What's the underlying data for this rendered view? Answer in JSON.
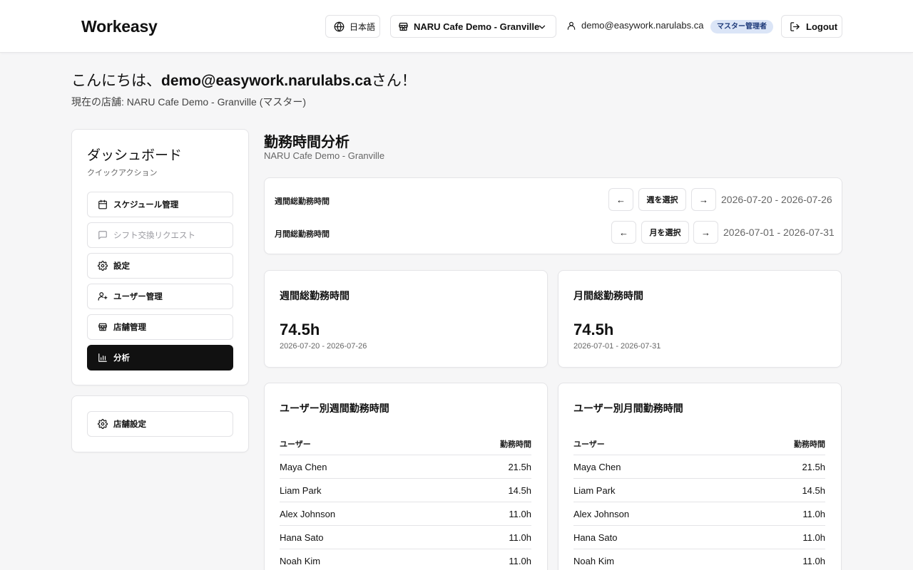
{
  "header": {
    "logo": "Workeasy",
    "language_label": "日本語",
    "store_name": "NARU Cafe Demo - Granville",
    "user_email": "demo@easywork.narulabs.ca",
    "role_badge": "マスター管理者",
    "logout_label": "Logout"
  },
  "greeting": {
    "prefix": "こんにちは、",
    "email": "demo@easywork.narulabs.ca",
    "suffix": "さん！",
    "current_store": "現在の店舗: NARU Cafe Demo - Granville (マスター)"
  },
  "sidebar": {
    "title": "ダッシュボード",
    "subtitle": "クイックアクション",
    "items": [
      {
        "label": "スケジュール管理",
        "icon": "calendar-icon",
        "state": "normal"
      },
      {
        "label": "シフト交換リクエスト",
        "icon": "message-icon",
        "state": "disabled"
      },
      {
        "label": "設定",
        "icon": "gear-icon",
        "state": "normal"
      },
      {
        "label": "ユーザー管理",
        "icon": "user-plus-icon",
        "state": "normal"
      },
      {
        "label": "店舗管理",
        "icon": "store-icon",
        "state": "normal"
      },
      {
        "label": "分析",
        "icon": "bar-chart-icon",
        "state": "active"
      }
    ],
    "store_settings_label": "店舗設定"
  },
  "main": {
    "title": "勤務時間分析",
    "subtitle": "NARU Cafe Demo - Granville",
    "week_selector": {
      "label": "週間総勤務時間",
      "select_label": "週を選択",
      "range": "2026-07-20 - 2026-07-26"
    },
    "month_selector": {
      "label": "月間総勤務時間",
      "select_label": "月を選択",
      "range": "2026-07-01 - 2026-07-31"
    },
    "weekly_total": {
      "title": "週間総勤務時間",
      "value": "74.5h",
      "range": "2026-07-20 - 2026-07-26"
    },
    "monthly_total": {
      "title": "月間総勤務時間",
      "value": "74.5h",
      "range": "2026-07-01 - 2026-07-31"
    },
    "weekly_by_user": {
      "title": "ユーザー別週間勤務時間",
      "col_user": "ユーザー",
      "col_hours": "勤務時間",
      "rows": [
        {
          "name": "Maya Chen",
          "hours": "21.5h"
        },
        {
          "name": "Liam Park",
          "hours": "14.5h"
        },
        {
          "name": "Alex Johnson",
          "hours": "11.0h"
        },
        {
          "name": "Hana Sato",
          "hours": "11.0h"
        },
        {
          "name": "Noah Kim",
          "hours": "11.0h"
        }
      ]
    },
    "monthly_by_user": {
      "title": "ユーザー別月間勤務時間",
      "col_user": "ユーザー",
      "col_hours": "勤務時間",
      "rows": [
        {
          "name": "Maya Chen",
          "hours": "21.5h"
        },
        {
          "name": "Liam Park",
          "hours": "14.5h"
        },
        {
          "name": "Alex Johnson",
          "hours": "11.0h"
        },
        {
          "name": "Hana Sato",
          "hours": "11.0h"
        },
        {
          "name": "Noah Kim",
          "hours": "11.0h"
        }
      ]
    }
  },
  "colors": {
    "background": "#f6f6f7",
    "active_nav": "#111111",
    "badge_bg": "#dbe5f7",
    "badge_text": "#1e3a7a"
  }
}
